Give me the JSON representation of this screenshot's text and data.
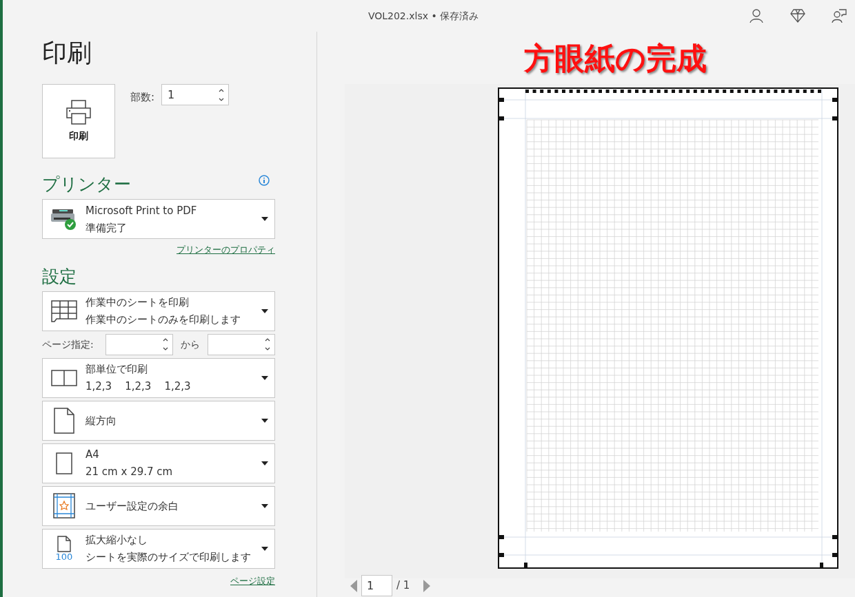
{
  "title_bar": {
    "document": "VOL202.xlsx • 保存済み"
  },
  "heading": "印刷",
  "print_button": {
    "label": "印刷"
  },
  "copies": {
    "label": "部数:",
    "value": "1"
  },
  "printer": {
    "title": "プリンター",
    "name": "Microsoft Print to PDF",
    "status": "準備完了",
    "properties_link": "プリンターのプロパティ"
  },
  "settings": {
    "title": "設定",
    "options": [
      {
        "kind": "sheet",
        "main": "作業中のシートを印刷",
        "sub": "作業中のシートのみを印刷します"
      },
      {
        "kind": "range",
        "label": "ページ指定:",
        "to_label": "から"
      },
      {
        "kind": "collate",
        "main": "部単位で印刷",
        "sub": "1,2,3    1,2,3    1,2,3"
      },
      {
        "kind": "portrait",
        "main": "縦方向"
      },
      {
        "kind": "paper",
        "main": "A4",
        "sub": "21 cm x 29.7 cm"
      },
      {
        "kind": "margins",
        "main": "ユーザー設定の余白"
      },
      {
        "kind": "scaling",
        "main": "拡大縮小なし",
        "sub": "シートを実際のサイズで印刷します",
        "icon_text": "100"
      }
    ],
    "page_setup_link": "ページ設定"
  },
  "preview": {
    "annotation": "方眼紙の完成",
    "current_page": "1",
    "total_pages": "/ 1"
  }
}
